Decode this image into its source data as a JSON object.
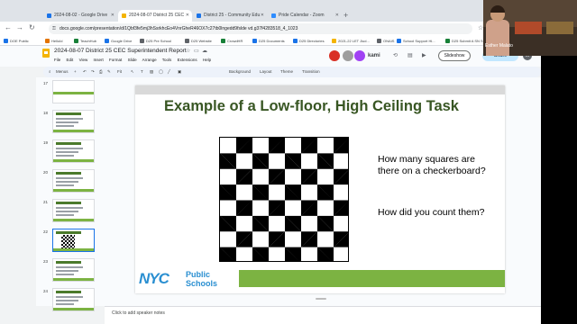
{
  "browser": {
    "tabs": [
      {
        "label": "2024-08-02 - Google Drive",
        "color": "#1a73e8"
      },
      {
        "label": "2024-08-07 District 25 CEC",
        "color": "#f4b400"
      },
      {
        "label": "District 25 - Community Edu",
        "color": "#1a73e8"
      },
      {
        "label": "Pride Calendar - Zoom",
        "color": "#2d8cff"
      }
    ],
    "address": "docs.google.com/presentation/d/1Qbf3fe5mj3hSsrkhcEo4VnrGheR46OX7c27tb0lngedd9fslde vd.g37f4283518_4_1023",
    "bookmarks": [
      "DOE Public",
      "HelloId",
      "TeachHub",
      "Google Drive",
      "D25 Pre School",
      "D25 Website",
      "CrowdHR",
      "D25 Documents",
      "D25 Directories",
      "2021-22 LET Jiud...",
      "ONAIS",
      "School Support Hi...",
      "D25 Submit A SN S..."
    ]
  },
  "docs": {
    "title": "2024-08-07 District 25 CEC Superintendent Report",
    "menu": [
      "File",
      "Edit",
      "View",
      "Insert",
      "Format",
      "Slide",
      "Arrange",
      "Tools",
      "Extensions",
      "Help"
    ],
    "kami": "kami",
    "slideshow": "Slideshow",
    "share": "Share",
    "user_initial": "M",
    "toolbar": {
      "menus": "Menus",
      "fit": "Fit",
      "background": "Background",
      "layout": "Layout",
      "theme": "Theme",
      "transition": "Transition"
    }
  },
  "filmstrip": {
    "slides": [
      {
        "num": "17",
        "kind": "bar"
      },
      {
        "num": "18",
        "kind": "text"
      },
      {
        "num": "19",
        "kind": "text"
      },
      {
        "num": "20",
        "kind": "text"
      },
      {
        "num": "21",
        "kind": "text"
      },
      {
        "num": "22",
        "kind": "board"
      },
      {
        "num": "23",
        "kind": "text"
      },
      {
        "num": "24",
        "kind": "text"
      }
    ]
  },
  "slide": {
    "title": "Example of a Low-floor, High Ceiling Task",
    "question1": "How many squares are there on a checkerboard?",
    "question2": "How did you count them?",
    "logo_nyc": "NYC",
    "logo_line1": "Public",
    "logo_line2": "Schools"
  },
  "notes": {
    "placeholder": "Click to add speaker notes"
  },
  "webcam": {
    "name": "Esther Malato"
  }
}
